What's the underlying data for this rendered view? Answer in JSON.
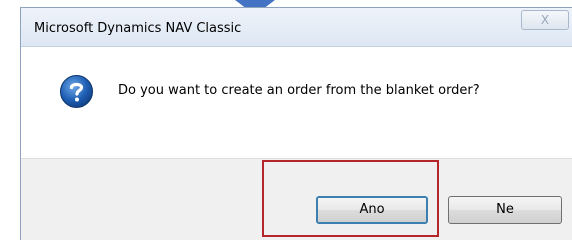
{
  "dialog": {
    "title": "Microsoft Dynamics NAV Classic",
    "close_glyph": "X",
    "message": "Do you want to create an order from the blanket order?",
    "icon": "question-icon"
  },
  "buttons": {
    "yes_label": "Ano",
    "no_label": "Ne"
  },
  "colors": {
    "highlight": "#b5262b",
    "arrow": "#4472c4",
    "icon_blue": "#1f5fb4"
  }
}
